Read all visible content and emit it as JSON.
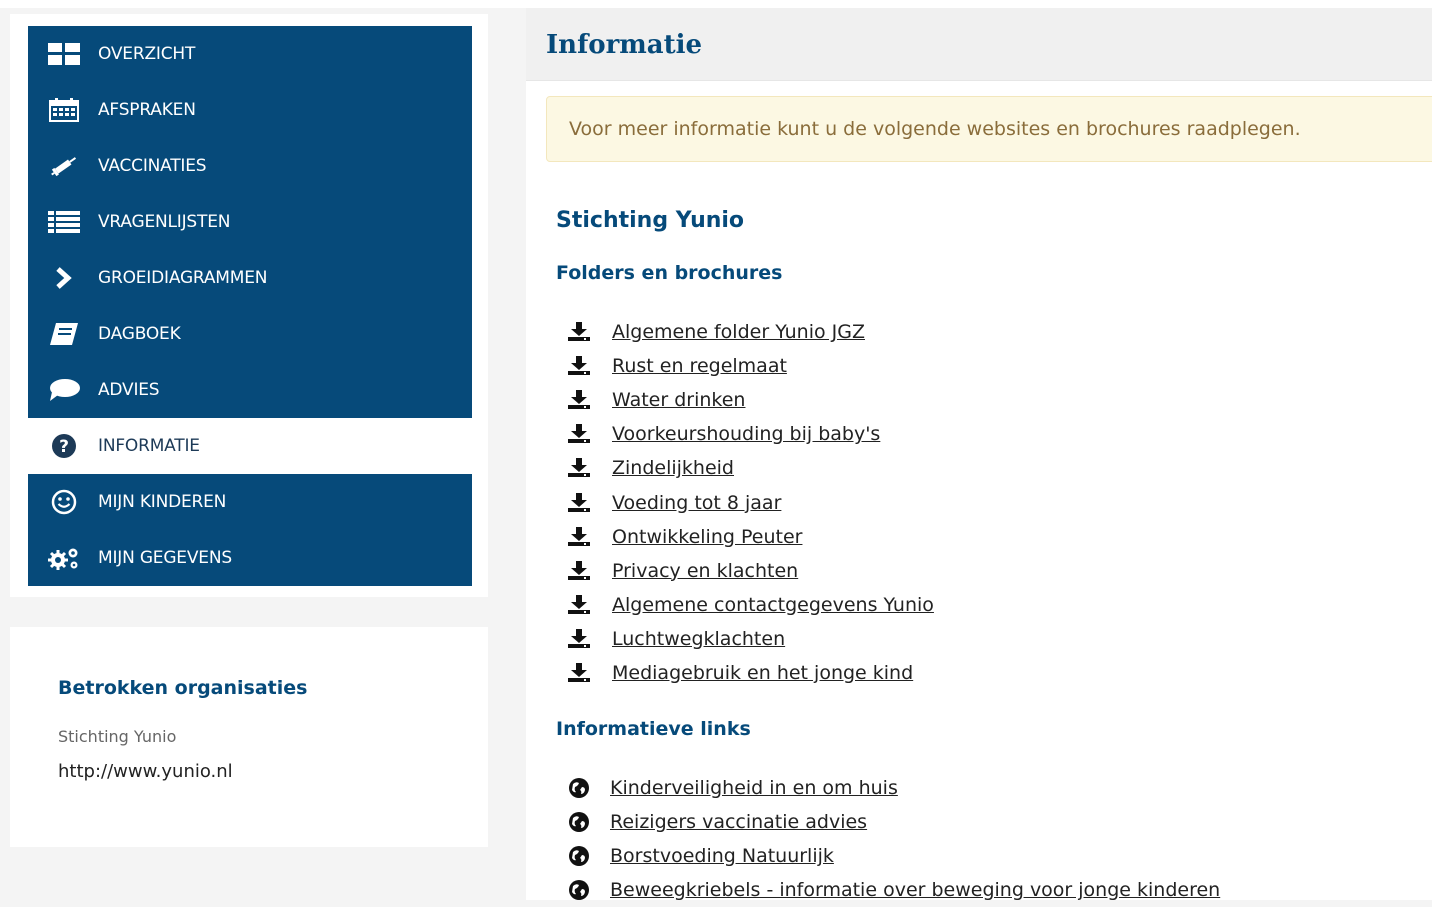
{
  "nav": {
    "items": [
      {
        "label": "OVERZICHT",
        "icon": "grid-icon"
      },
      {
        "label": "AFSPRAKEN",
        "icon": "calendar-icon"
      },
      {
        "label": "VACCINATIES",
        "icon": "syringe-icon"
      },
      {
        "label": "VRAGENLIJSTEN",
        "icon": "list-icon"
      },
      {
        "label": "GROEIDIAGRAMMEN",
        "icon": "chevron-right-icon"
      },
      {
        "label": "DAGBOEK",
        "icon": "book-icon"
      },
      {
        "label": "ADVIES",
        "icon": "speech-bubble-icon"
      },
      {
        "label": "INFORMATIE",
        "icon": "question-circle-icon"
      },
      {
        "label": "MIJN KINDEREN",
        "icon": "smiley-icon"
      },
      {
        "label": "MIJN GEGEVENS",
        "icon": "gears-icon"
      }
    ],
    "active_index": 7
  },
  "org": {
    "title": "Betrokken organisaties",
    "name": "Stichting Yunio",
    "url": "http://www.yunio.nl"
  },
  "main": {
    "title": "Informatie",
    "alert": "Voor meer informatie kunt u de volgende websites en brochures raadplegen.",
    "org_heading": "Stichting Yunio",
    "folders_heading": "Folders en brochures",
    "folders": [
      "Algemene folder Yunio JGZ",
      "Rust en regelmaat",
      "Water drinken",
      "Voorkeurshouding bij baby's",
      "Zindelijkheid",
      "Voeding tot 8 jaar",
      "Ontwikkeling Peuter",
      "Privacy en klachten",
      "Algemene contactgegevens Yunio",
      "Luchtwegklachten",
      "Mediagebruik en het jonge kind"
    ],
    "links_heading": "Informatieve links",
    "links": [
      "Kinderveiligheid in en om huis",
      "Reizigers vaccinatie advies",
      "Borstvoeding Natuurlijk",
      "Beweegkriebels - informatie over beweging voor jonge kinderen"
    ]
  },
  "colors": {
    "nav_bg": "#064a7a",
    "heading": "#064a7a",
    "alert_bg": "#fcf8e3",
    "alert_text": "#8a6d3b"
  }
}
